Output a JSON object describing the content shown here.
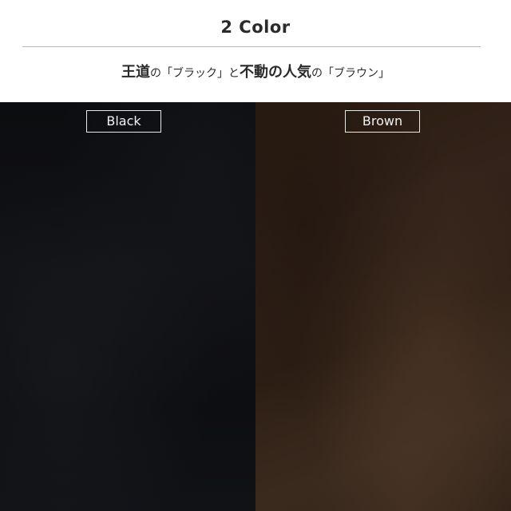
{
  "header": {
    "title": "2 Color",
    "tagline": {
      "part1": "王道",
      "part2": "の「ブラック」と",
      "part3": "不動の人気",
      "part4": "の「ブラウン」"
    }
  },
  "swatches": [
    {
      "label": "Black",
      "color": "#0e0f12"
    },
    {
      "label": "Brown",
      "color": "#30211a"
    }
  ]
}
